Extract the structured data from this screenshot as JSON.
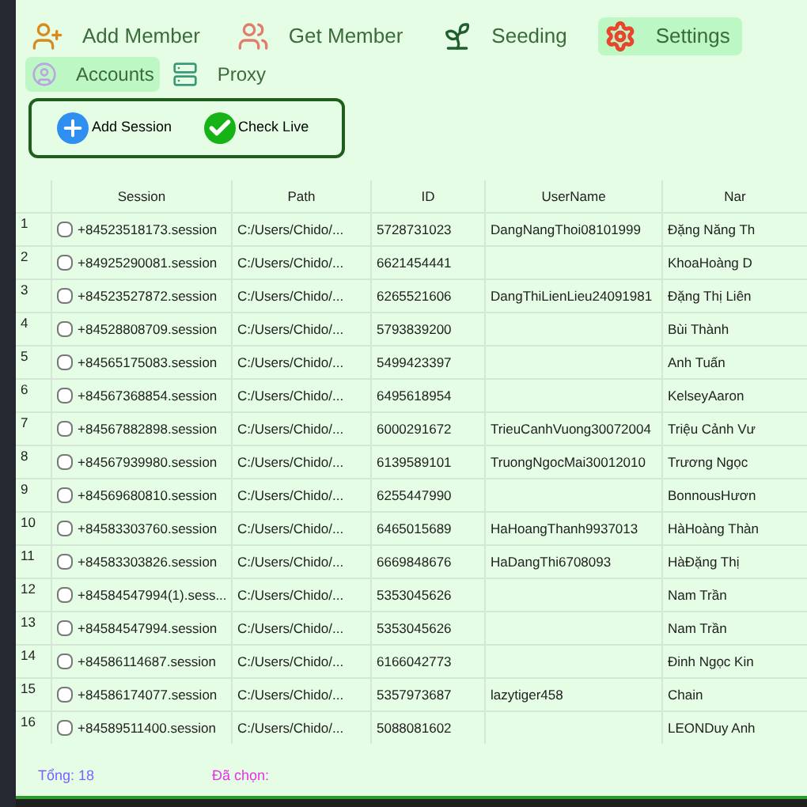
{
  "nav": [
    {
      "label": "Add Member",
      "selected": false
    },
    {
      "label": "Get Member",
      "selected": false
    },
    {
      "label": "Seeding",
      "selected": false
    },
    {
      "label": "Settings",
      "selected": true
    }
  ],
  "subtabs": [
    {
      "label": "Accounts",
      "selected": true
    },
    {
      "label": "Proxy",
      "selected": false
    }
  ],
  "actions": [
    {
      "label": "Add Session"
    },
    {
      "label": "Check Live"
    }
  ],
  "table": {
    "columns": [
      "Session",
      "Path",
      "ID",
      "UserName",
      "Nar"
    ],
    "rows": [
      {
        "index": "1",
        "checked": false,
        "session": "+84523518173.session",
        "path": "C:/Users/Chido/...",
        "id": "5728731023",
        "username": "DangNangThoi08101999",
        "name": "Đặng Năng Th"
      },
      {
        "index": "2",
        "checked": false,
        "session": "+84925290081.session",
        "path": "C:/Users/Chido/...",
        "id": "6621454441",
        "username": "",
        "name": "KhoaHoàng D"
      },
      {
        "index": "3",
        "checked": false,
        "session": "+84523527872.session",
        "path": "C:/Users/Chido/...",
        "id": "6265521606",
        "username": "DangThiLienLieu24091981",
        "name": "Đặng Thị Liên"
      },
      {
        "index": "4",
        "checked": false,
        "session": "+84528808709.session",
        "path": "C:/Users/Chido/...",
        "id": "5793839200",
        "username": "",
        "name": "Bùi Thành"
      },
      {
        "index": "5",
        "checked": false,
        "session": "+84565175083.session",
        "path": "C:/Users/Chido/...",
        "id": "5499423397",
        "username": "",
        "name": "Anh Tuấn"
      },
      {
        "index": "6",
        "checked": false,
        "session": "+84567368854.session",
        "path": "C:/Users/Chido/...",
        "id": "6495618954",
        "username": "",
        "name": "KelseyAaron"
      },
      {
        "index": "7",
        "checked": false,
        "session": "+84567882898.session",
        "path": "C:/Users/Chido/...",
        "id": "6000291672",
        "username": "TrieuCanhVuong30072004",
        "name": "Triệu Cảnh Vư"
      },
      {
        "index": "8",
        "checked": false,
        "session": "+84567939980.session",
        "path": "C:/Users/Chido/...",
        "id": "6139589101",
        "username": "TruongNgocMai30012010",
        "name": "Trương Ngọc"
      },
      {
        "index": "9",
        "checked": false,
        "session": "+84569680810.session",
        "path": "C:/Users/Chido/...",
        "id": "6255447990",
        "username": "",
        "name": "BonnousHươn"
      },
      {
        "index": "10",
        "checked": false,
        "session": "+84583303760.session",
        "path": "C:/Users/Chido/...",
        "id": "6465015689",
        "username": "HaHoangThanh9937013",
        "name": "HàHoàng Thàn"
      },
      {
        "index": "11",
        "checked": false,
        "session": "+84583303826.session",
        "path": "C:/Users/Chido/...",
        "id": "6669848676",
        "username": "HaDangThi6708093",
        "name": "HàĐặng Thị"
      },
      {
        "index": "12",
        "checked": false,
        "session": "+84584547994(1).sess...",
        "path": "C:/Users/Chido/...",
        "id": "5353045626",
        "username": "",
        "name": "Nam Trần"
      },
      {
        "index": "13",
        "checked": false,
        "session": "+84584547994.session",
        "path": "C:/Users/Chido/...",
        "id": "5353045626",
        "username": "",
        "name": "Nam Trần"
      },
      {
        "index": "14",
        "checked": false,
        "session": "+84586114687.session",
        "path": "C:/Users/Chido/...",
        "id": "6166042773",
        "username": "",
        "name": "Đinh Ngọc Kin"
      },
      {
        "index": "15",
        "checked": false,
        "session": "+84586174077.session",
        "path": "C:/Users/Chido/...",
        "id": "5357973687",
        "username": "lazytiger458",
        "name": "Chain"
      },
      {
        "index": "16",
        "checked": false,
        "session": "+84589511400.session",
        "path": "C:/Users/Chido/...",
        "id": "5088081602",
        "username": "",
        "name": "LEONDuy Anh"
      }
    ]
  },
  "footer": {
    "total": "Tổng: 18",
    "selected_label": "Đã chọn:"
  }
}
